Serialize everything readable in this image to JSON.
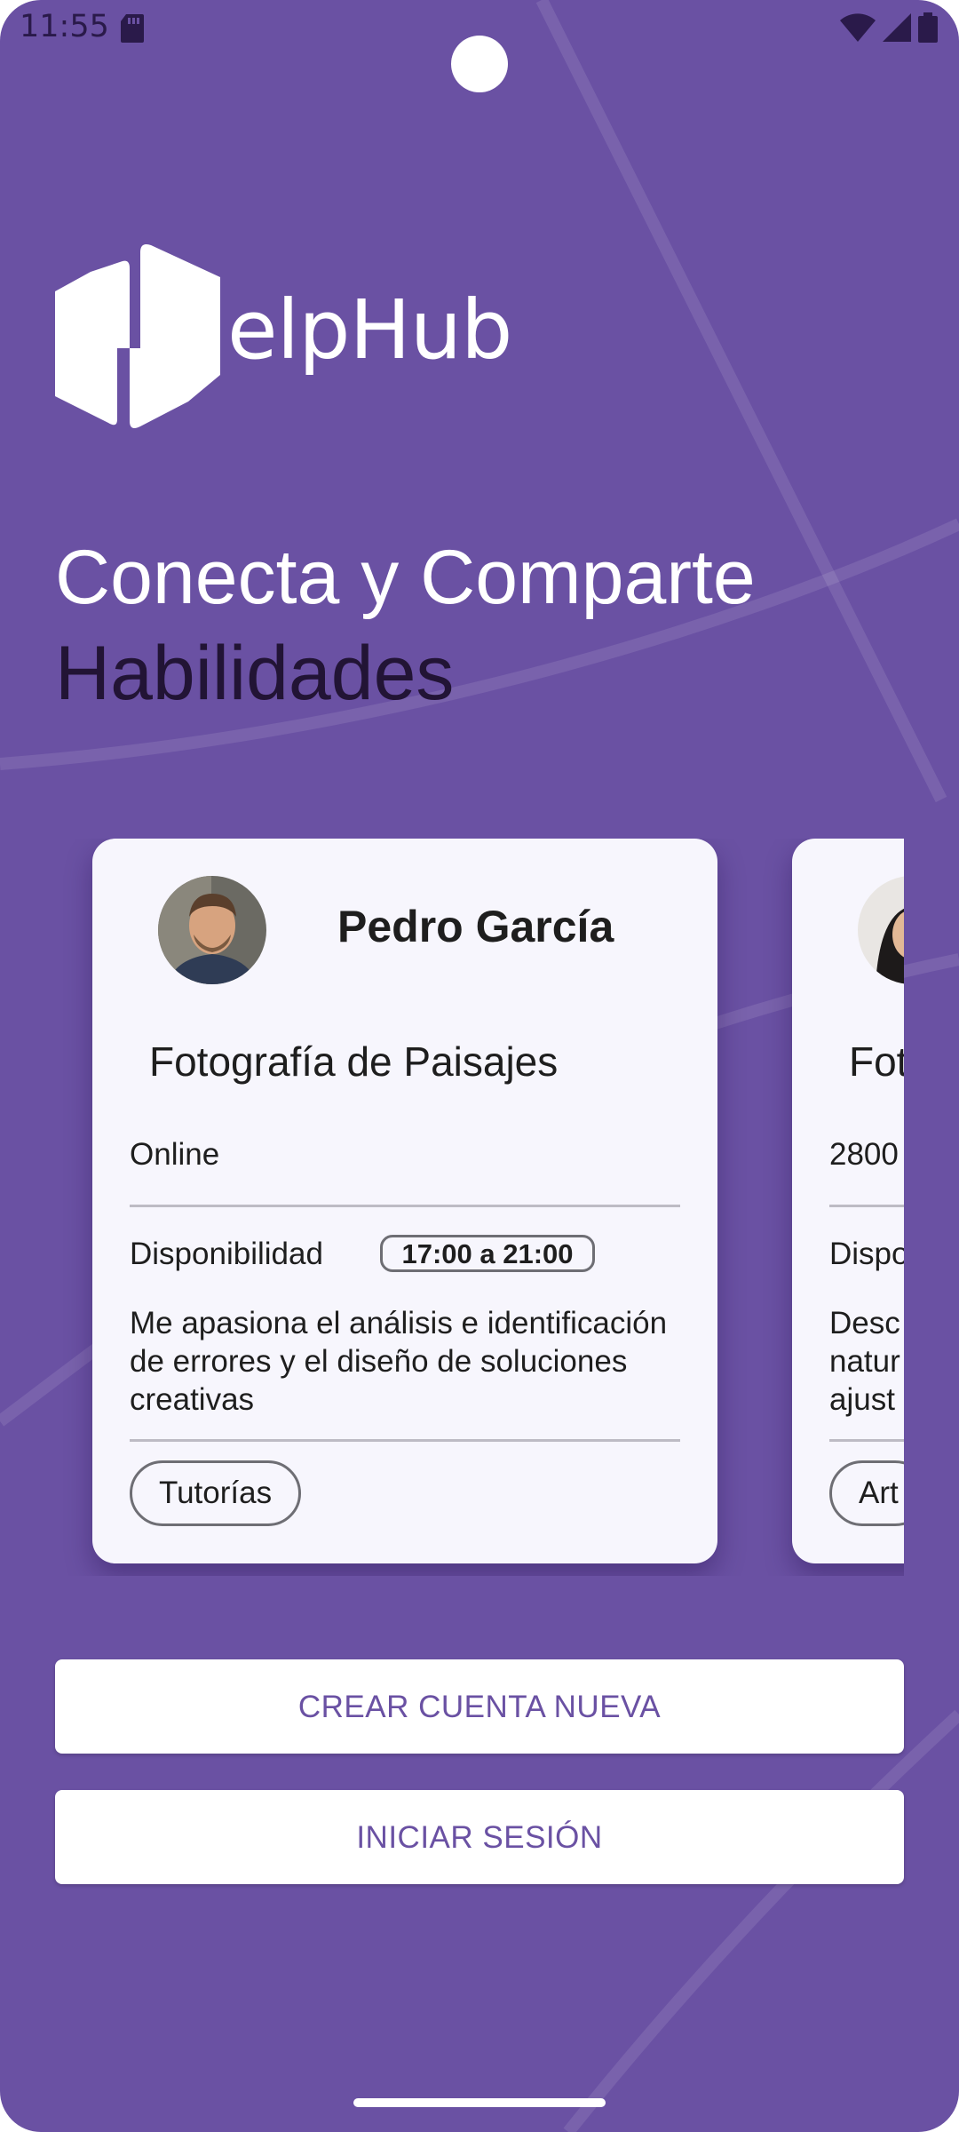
{
  "status_bar": {
    "time": "11:55",
    "icons": [
      "sd-card-icon",
      "wifi-icon",
      "signal-icon",
      "battery-icon"
    ]
  },
  "app": {
    "logo_text": "elpHub",
    "logo_icon": "helphub-h-logo"
  },
  "hero": {
    "line1": "Conecta y Comparte",
    "line2": "Habilidades"
  },
  "cards": [
    {
      "name": "Pedro García",
      "skill": "Fotografía de Paisajes",
      "location": "Online",
      "availability_label": "Disponibilidad",
      "availability_time": "17:00 a 21:00",
      "description": "Me apasiona el análisis e identificación de errores y el diseño de soluciones creativas",
      "tag": "Tutorías"
    },
    {
      "skill": "Fot",
      "location": "2800",
      "availability_label": "Dispo",
      "description": "Desc natur ajust",
      "tag": "Art"
    }
  ],
  "buttons": {
    "create_account": "CREAR CUENTA NUEVA",
    "login": "INICIAR SESIÓN"
  },
  "colors": {
    "background": "#6a51a3",
    "card": "#f7f6fd",
    "button_text": "#6a51a3",
    "headline_dark": "#221435"
  }
}
